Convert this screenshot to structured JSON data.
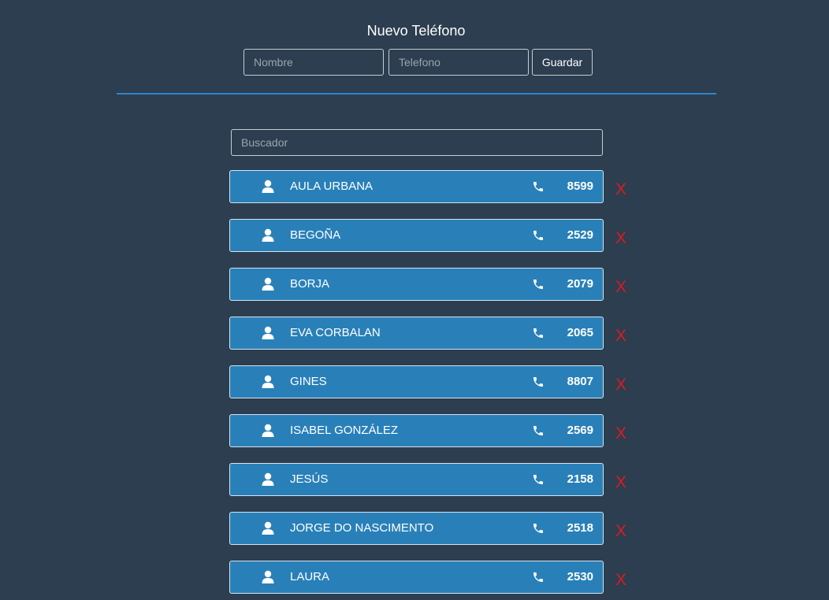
{
  "form": {
    "title": "Nuevo Teléfono",
    "name_placeholder": "Nombre",
    "phone_placeholder": "Telefono",
    "save_label": "Guardar"
  },
  "search": {
    "placeholder": "Buscador"
  },
  "colors": {
    "background": "#2c3e50",
    "accent": "#2980b9",
    "delete": "#e0191f"
  },
  "icons": {
    "user": "user-icon",
    "phone": "phone-icon"
  },
  "delete_label": "X",
  "contacts": [
    {
      "name": "AULA URBANA",
      "phone": "8599"
    },
    {
      "name": "BEGOÑA",
      "phone": "2529"
    },
    {
      "name": "BORJA",
      "phone": "2079"
    },
    {
      "name": "EVA CORBALAN",
      "phone": "2065"
    },
    {
      "name": "GINES",
      "phone": "8807"
    },
    {
      "name": "ISABEL GONZÁLEZ",
      "phone": "2569"
    },
    {
      "name": "JESÚS",
      "phone": "2158"
    },
    {
      "name": "JORGE DO NASCIMENTO",
      "phone": "2518"
    },
    {
      "name": "LAURA",
      "phone": "2530"
    }
  ]
}
